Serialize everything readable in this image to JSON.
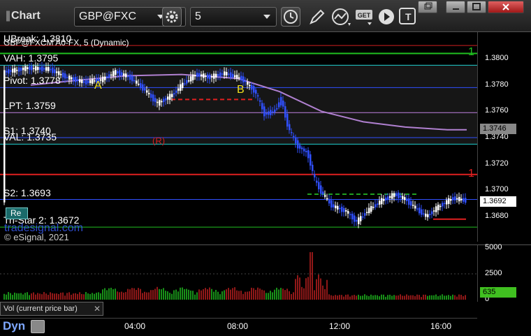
{
  "toolbar": {
    "title": "Chart",
    "symbol": "GBP@FXC",
    "interval": "5",
    "icons": [
      "gear-icon",
      "clock-icon",
      "pencil-icon",
      "studies-icon",
      "get-icon",
      "play-icon",
      "text-icon"
    ],
    "window_buttons": [
      "restore-icon",
      "minimize-icon",
      "maximize-icon",
      "close-icon"
    ]
  },
  "chart_header": {
    "symbol_line": "GBP@FXCM A0-FX, 5 (Dynamic)"
  },
  "levels": [
    {
      "label": "UBreak: 1.3810",
      "value": 1.381,
      "color": "#d02020"
    },
    {
      "label": "VAH: 1.3795",
      "value": 1.3795,
      "color": "#20d0d0"
    },
    {
      "label": "Pivot: 1.3778",
      "value": 1.3778,
      "color": "#3050ff"
    },
    {
      "label": "LPT: 1.3759",
      "value": 1.3759,
      "color": "#c080e0"
    },
    {
      "label": "S1: 1.3740",
      "value": 1.374,
      "color": "#3050ff"
    },
    {
      "label": "VAL: 1.3735",
      "value": 1.3735,
      "color": "#20d0d0"
    },
    {
      "label": "S2: 1.3693",
      "value": 1.3693,
      "color": "#3050ff"
    },
    {
      "label": "Tri-Star 2: 1.3672",
      "value": 1.3672,
      "color": "#20c020"
    }
  ],
  "extra_levels": [
    {
      "value": 1.3804,
      "color": "#20c020"
    },
    {
      "value": 1.3712,
      "color": "#e02020"
    }
  ],
  "price_axis": {
    "ticks": [
      "1.3800",
      "1.3780",
      "1.3760",
      "1.3740",
      "1.3720",
      "1.3700",
      "1.3680"
    ],
    "tick_values": [
      1.38,
      1.378,
      1.376,
      1.374,
      1.372,
      1.37,
      1.368
    ],
    "ma_value": "1.3746",
    "last_price": "1.3692"
  },
  "annotations": {
    "copyright": "© eSignal, 2021",
    "watermark": "tradesignal.com",
    "marker_a": "A",
    "marker_b": "B",
    "marker_r": "(R)",
    "count_1_top": "1",
    "count_1_right": "1",
    "button_re": "Re"
  },
  "volume": {
    "label": "Vol (current price bar)",
    "ticks": [
      "5000",
      "2500",
      "0"
    ],
    "tick_values": [
      5000,
      2500,
      0
    ],
    "last": "635"
  },
  "time_axis": [
    "04:00",
    "08:00",
    "12:00",
    "16:00"
  ],
  "footer": {
    "dyn": "Dyn"
  }
}
